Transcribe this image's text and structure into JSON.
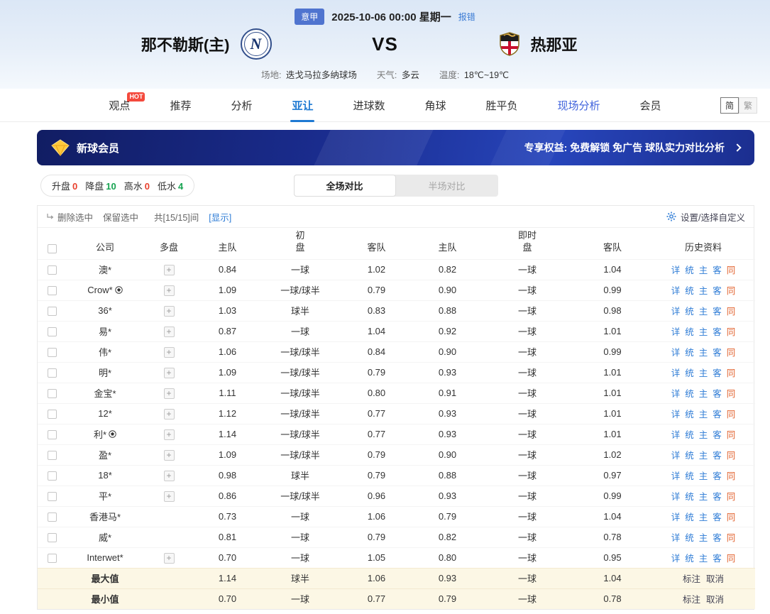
{
  "header": {
    "league": "意甲",
    "datetime": "2025-10-06 00:00 星期一",
    "report_error": "报错",
    "home_team": "那不勒斯(主)",
    "home_logo_letter": "N",
    "vs": "VS",
    "away_team": "热那亚",
    "info": {
      "venue_label": "场地:",
      "venue": "迭戈马拉多纳球场",
      "weather_label": "天气:",
      "weather": "多云",
      "temp_label": "温度:",
      "temp": "18℃~19℃"
    }
  },
  "nav": {
    "items": [
      {
        "key": "viewpoint",
        "label": "观点",
        "badge": "HOT"
      },
      {
        "key": "recommend",
        "label": "推荐"
      },
      {
        "key": "analysis",
        "label": "分析"
      },
      {
        "key": "asian-handicap",
        "label": "亚让",
        "active": true
      },
      {
        "key": "goals",
        "label": "进球数"
      },
      {
        "key": "corner",
        "label": "角球"
      },
      {
        "key": "win-draw-lose",
        "label": "胜平负"
      },
      {
        "key": "live-analysis",
        "label": "现场分析",
        "highlight": true
      },
      {
        "key": "member",
        "label": "会员"
      }
    ],
    "lang": {
      "simplified": "简",
      "traditional": "繁"
    }
  },
  "promo": {
    "title": "新球会员",
    "benefits": "专享权益: 免费解锁 免广告 球队实力对比分析"
  },
  "filters": {
    "stats": [
      {
        "key": "rise",
        "label": "升盘",
        "value": "0",
        "color": "#e8402d"
      },
      {
        "key": "drop",
        "label": "降盘",
        "value": "10",
        "color": "#18a452"
      },
      {
        "key": "high-water",
        "label": "高水",
        "value": "0",
        "color": "#e8402d"
      },
      {
        "key": "low-water",
        "label": "低水",
        "value": "4",
        "color": "#18a452"
      }
    ],
    "full_compare": "全场对比",
    "half_compare": "半场对比"
  },
  "toolbar": {
    "delete_selected": "删除选中",
    "keep_selected": "保留选中",
    "count_text": "共[15/15]间",
    "show_link": "[显示]",
    "settings_label": "设置/选择自定义"
  },
  "icons": {
    "plus": "+"
  },
  "table": {
    "headers": {
      "company": "公司",
      "multi": "多盘",
      "home": "主队",
      "away": "客队",
      "home2": "主队",
      "away2": "客队",
      "initial_top": "初",
      "live_top": "即时",
      "handicap": "盘",
      "handicap2": "盘",
      "history": "历史资料"
    },
    "history_links": [
      "详",
      "统",
      "主",
      "客",
      "同"
    ],
    "rows": [
      {
        "company": "澳*",
        "ball": false,
        "multi": true,
        "initial": {
          "home": "0.84",
          "handicap": "一球",
          "away": "1.02"
        },
        "live": {
          "home": "0.82",
          "handicap": "一球",
          "away": "1.04"
        }
      },
      {
        "company": "Crow*",
        "ball": true,
        "multi": true,
        "initial": {
          "home": "1.09",
          "handicap": "一球/球半",
          "away": "0.79"
        },
        "live": {
          "home": "0.90",
          "handicap": "一球",
          "away": "0.99"
        }
      },
      {
        "company": "36*",
        "ball": false,
        "multi": true,
        "initial": {
          "home": "1.03",
          "handicap": "球半",
          "away": "0.83"
        },
        "live": {
          "home": "0.88",
          "handicap": "一球",
          "away": "0.98"
        }
      },
      {
        "company": "易*",
        "ball": false,
        "multi": true,
        "initial": {
          "home": "0.87",
          "handicap": "一球",
          "away": "1.04"
        },
        "live": {
          "home": "0.92",
          "handicap": "一球",
          "away": "1.01"
        }
      },
      {
        "company": "伟*",
        "ball": false,
        "multi": true,
        "initial": {
          "home": "1.06",
          "handicap": "一球/球半",
          "away": "0.84"
        },
        "live": {
          "home": "0.90",
          "handicap": "一球",
          "away": "0.99"
        }
      },
      {
        "company": "明*",
        "ball": false,
        "multi": true,
        "initial": {
          "home": "1.09",
          "handicap": "一球/球半",
          "away": "0.79"
        },
        "live": {
          "home": "0.93",
          "handicap": "一球",
          "away": "1.01"
        }
      },
      {
        "company": "金宝*",
        "ball": false,
        "multi": true,
        "initial": {
          "home": "1.11",
          "handicap": "一球/球半",
          "away": "0.80"
        },
        "live": {
          "home": "0.91",
          "handicap": "一球",
          "away": "1.01"
        }
      },
      {
        "company": "12*",
        "ball": false,
        "multi": true,
        "initial": {
          "home": "1.12",
          "handicap": "一球/球半",
          "away": "0.77"
        },
        "live": {
          "home": "0.93",
          "handicap": "一球",
          "away": "1.01"
        }
      },
      {
        "company": "利*",
        "ball": true,
        "multi": true,
        "initial": {
          "home": "1.14",
          "handicap": "一球/球半",
          "away": "0.77"
        },
        "live": {
          "home": "0.93",
          "handicap": "一球",
          "away": "1.01"
        }
      },
      {
        "company": "盈*",
        "ball": false,
        "multi": true,
        "initial": {
          "home": "1.09",
          "handicap": "一球/球半",
          "away": "0.79"
        },
        "live": {
          "home": "0.90",
          "handicap": "一球",
          "away": "1.02"
        }
      },
      {
        "company": "18*",
        "ball": false,
        "multi": true,
        "initial": {
          "home": "0.98",
          "handicap": "球半",
          "away": "0.79"
        },
        "live": {
          "home": "0.88",
          "handicap": "一球",
          "away": "0.97"
        }
      },
      {
        "company": "平*",
        "ball": false,
        "multi": true,
        "initial": {
          "home": "0.86",
          "handicap": "一球/球半",
          "away": "0.96"
        },
        "live": {
          "home": "0.93",
          "handicap": "一球",
          "away": "0.99"
        }
      },
      {
        "company": "香港马*",
        "ball": false,
        "multi": false,
        "initial": {
          "home": "0.73",
          "handicap": "一球",
          "away": "1.06"
        },
        "live": {
          "home": "0.79",
          "handicap": "一球",
          "away": "1.04"
        }
      },
      {
        "company": "威*",
        "ball": false,
        "multi": false,
        "initial": {
          "home": "0.81",
          "handicap": "一球",
          "away": "0.79"
        },
        "live": {
          "home": "0.82",
          "handicap": "一球",
          "away": "0.78"
        }
      },
      {
        "company": "Interwet*",
        "ball": false,
        "multi": true,
        "initial": {
          "home": "0.70",
          "handicap": "一球",
          "away": "1.05"
        },
        "live": {
          "home": "0.80",
          "handicap": "一球",
          "away": "0.95"
        }
      }
    ],
    "summary": [
      {
        "label": "最大值",
        "initial": {
          "home": "1.14",
          "handicap": "球半",
          "away": "1.06"
        },
        "live": {
          "home": "0.93",
          "handicap": "一球",
          "away": "1.04"
        },
        "links": [
          "标注",
          "取消"
        ]
      },
      {
        "label": "最小值",
        "initial": {
          "home": "0.70",
          "handicap": "一球",
          "away": "0.77"
        },
        "live": {
          "home": "0.79",
          "handicap": "一球",
          "away": "0.78"
        },
        "links": [
          "标注",
          "取消"
        ]
      }
    ]
  }
}
